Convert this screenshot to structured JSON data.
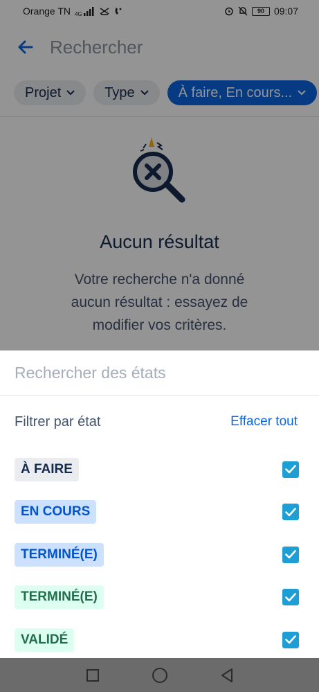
{
  "status_bar": {
    "carrier": "Orange TN",
    "net_type": "4G",
    "battery": "90",
    "time": "09:07"
  },
  "app_bar": {
    "title": "Rechercher"
  },
  "filter_chips": [
    {
      "label": "Projet"
    },
    {
      "label": "Type"
    },
    {
      "label": "À faire, En cours..."
    }
  ],
  "empty_state": {
    "title": "Aucun résultat",
    "description": "Votre recherche n'a donné aucun résultat : essayez de modifier vos critères."
  },
  "sheet": {
    "search_placeholder": "Rechercher des états",
    "filter_label": "Filtrer par état",
    "clear_all": "Effacer tout",
    "statuses": [
      {
        "label": "À FAIRE",
        "bg": "#ebecf0",
        "fg": "#172b4d",
        "checked": true
      },
      {
        "label": "EN COURS",
        "bg": "#cce0ff",
        "fg": "#0055cc",
        "checked": true
      },
      {
        "label": "TERMINÉ(E)",
        "bg": "#cce0ff",
        "fg": "#0055cc",
        "checked": true
      },
      {
        "label": "TERMINÉ(E)",
        "bg": "#dcfff1",
        "fg": "#216e4e",
        "checked": true
      },
      {
        "label": "VALIDÉ",
        "bg": "#dcfff1",
        "fg": "#216e4e",
        "checked": true
      }
    ]
  },
  "colors": {
    "primary": "#0c66e4",
    "checkbox": "#1d9fd6"
  }
}
